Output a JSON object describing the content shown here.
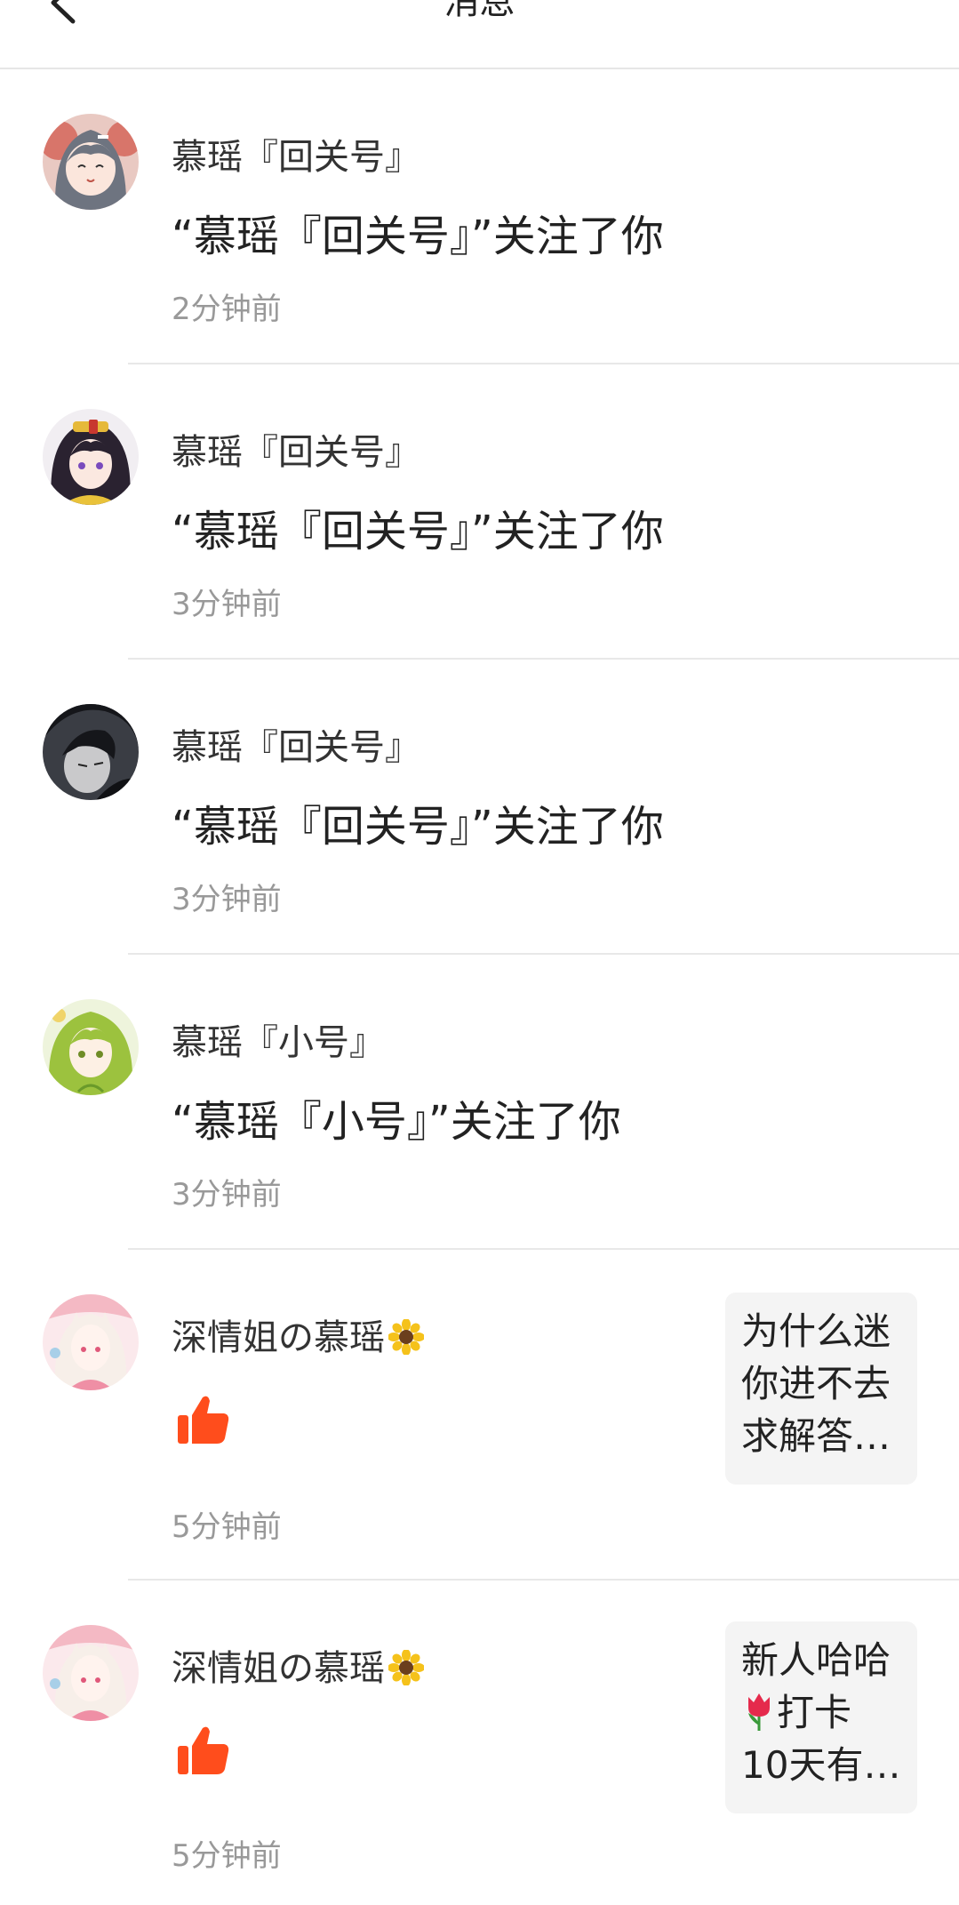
{
  "header": {
    "title": "消息"
  },
  "messages": [
    {
      "name": "慕瑶『回关号』",
      "text": "“慕瑶『回关号』”关注了你",
      "time": "2分钟前",
      "avatar_icon": "avatar-girl-grey-hair"
    },
    {
      "name": "慕瑶『回关号』",
      "text": "“慕瑶『回关号』”关注了你",
      "time": "3分钟前",
      "avatar_icon": "avatar-girl-dark-hair"
    },
    {
      "name": "慕瑶『回关号』",
      "text": "“慕瑶『回关号』”关注了你",
      "time": "3分钟前",
      "avatar_icon": "avatar-boy-dark"
    },
    {
      "name": "慕瑶『小号』",
      "text": "“慕瑶『小号』”关注了你",
      "time": "3分钟前",
      "avatar_icon": "avatar-girl-green-hair"
    },
    {
      "name": "深情姐の慕瑶",
      "time": "5分钟前",
      "avatar_icon": "avatar-girl-pink",
      "action_icon": "thumbs-up-icon",
      "preview_lines": [
        "为什么迷",
        "你进不去",
        "求解答…"
      ]
    },
    {
      "name": "深情姐の慕瑶",
      "time": "5分钟前",
      "avatar_icon": "avatar-girl-pink",
      "action_icon": "thumbs-up-icon",
      "preview_lines": [
        "新人哈哈",
        "打卡",
        "10天有…"
      ]
    }
  ],
  "colors": {
    "like": "#FF4D1C",
    "time": "#999999",
    "divider": "#E8E8E8"
  }
}
